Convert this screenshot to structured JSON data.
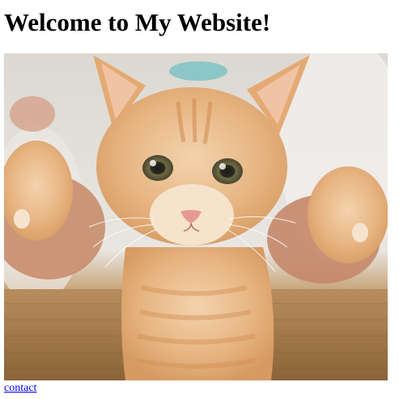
{
  "page": {
    "heading": "Welcome to My Website!",
    "image_alt": "Orange tabby kitten held up by a person's hands",
    "contact_link": "contact"
  },
  "colors": {
    "link": "#0000ee",
    "text": "#000000",
    "background": "#ffffff"
  }
}
